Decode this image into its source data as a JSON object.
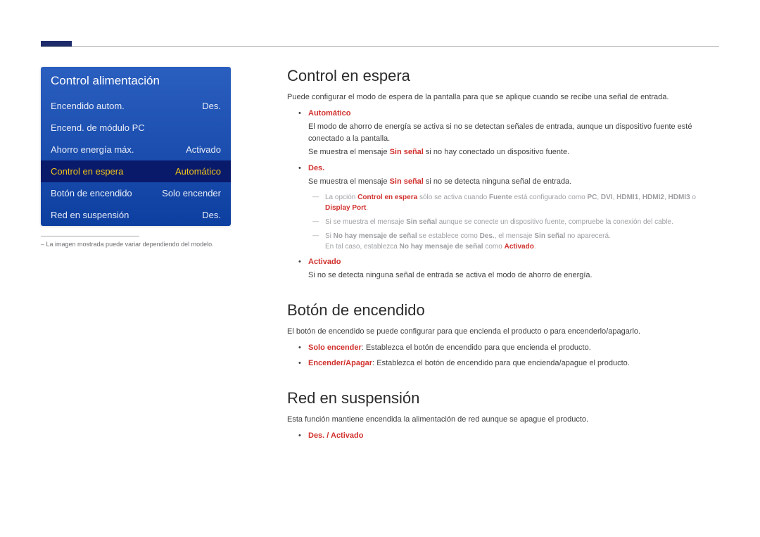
{
  "menu": {
    "title": "Control alimentación",
    "items": [
      {
        "label": "Encendido autom.",
        "value": "Des."
      },
      {
        "label": "Encend. de módulo PC",
        "value": ""
      },
      {
        "label": "Ahorro energía máx.",
        "value": "Activado"
      },
      {
        "label": "Control en espera",
        "value": "Automático"
      },
      {
        "label": "Botón de encendido",
        "value": "Solo encender"
      },
      {
        "label": "Red en suspensión",
        "value": "Des."
      }
    ],
    "footnote": "La imagen mostrada puede variar dependiendo del modelo."
  },
  "sections": {
    "standby": {
      "title": "Control en espera",
      "intro": "Puede configurar el modo de espera de la pantalla para que se aplique cuando se recibe una señal de entrada.",
      "auto": {
        "label": "Automático",
        "line1a": "El modo de ahorro de energía se activa si no se detectan señales de entrada, aunque un dispositivo fuente esté conectado a la pantalla.",
        "line2a": "Se muestra el mensaje ",
        "line2b": "Sin señal",
        "line2c": " si no hay conectado un dispositivo fuente."
      },
      "des": {
        "label": "Des.",
        "line1a": "Se muestra el mensaje ",
        "line1b": "Sin señal",
        "line1c": " si no se detecta ninguna señal de entrada."
      },
      "notes": {
        "n1a": "La opción ",
        "n1b": "Control en espera",
        "n1c": " sólo se activa cuando ",
        "n1d": "Fuente",
        "n1e": " está configurado como ",
        "ports": [
          "PC",
          "DVI",
          "HDMI1",
          "HDMI2",
          "HDMI3"
        ],
        "n1dp": "Display Port",
        "n1end": ".",
        "n2a": "Si se muestra el mensaje ",
        "n2b": "Sin señal",
        "n2c": " aunque se conecte un dispositivo fuente, compruebe la conexión del cable.",
        "n3a": "Si ",
        "n3b": "No hay mensaje de señal",
        "n3c": " se establece como ",
        "n3d": "Des.",
        "n3e": ", el mensaje ",
        "n3f": "Sin señal",
        "n3g": " no aparecerá.",
        "n3line2a": "En tal caso, establezca ",
        "n3line2b": "No hay mensaje de señal",
        "n3line2c": " como ",
        "n3line2d": "Activado",
        "n3line2e": "."
      },
      "activado": {
        "label": "Activado",
        "line": "Si no se detecta ninguna señal de entrada se activa el modo de ahorro de energía."
      }
    },
    "power_button": {
      "title": "Botón de encendido",
      "intro": "El botón de encendido se puede configurar para que encienda el producto o para encenderlo/apagarlo.",
      "opt1_label": "Solo encender",
      "opt1_text": ": Establezca el botón de encendido para que encienda el producto.",
      "opt2_label": "Encender/Apagar",
      "opt2_text": ": Establezca el botón de encendido para que encienda/apague el producto."
    },
    "network_standby": {
      "title": "Red en suspensión",
      "intro": "Esta función mantiene encendida la alimentación de red aunque se apague el producto.",
      "opt": "Des. / Activado"
    }
  }
}
